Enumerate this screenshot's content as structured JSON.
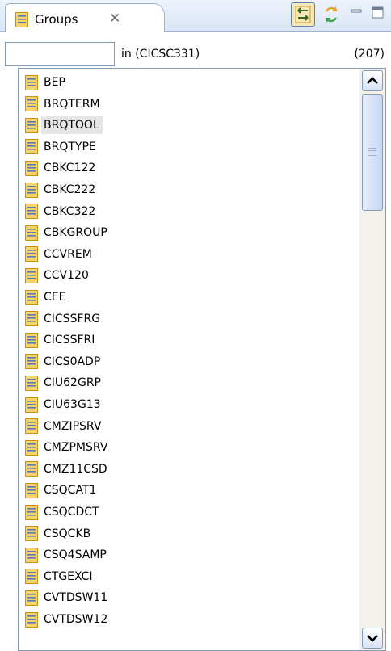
{
  "view": {
    "tab_label": "Groups",
    "tab_close_glyph": "✕",
    "icons": {
      "tab": "group-document-icon",
      "link": "link-with-editor-icon",
      "sync": "sync-icon",
      "minimize": "minimize-icon",
      "maximize": "maximize-icon"
    }
  },
  "filter": {
    "value": "",
    "placeholder": "",
    "scope_text": "in (CICSC331)",
    "count_text": "(207)"
  },
  "list": {
    "item_icon": "group-document-icon",
    "selected_index": 2,
    "items": [
      "BEP",
      "BRQTERM",
      "BRQTOOL",
      "BRQTYPE",
      "CBKC122",
      "CBKC222",
      "CBKC322",
      "CBKGROUP",
      "CCVREM",
      "CCV120",
      "CEE",
      "CICSSFRG",
      "CICSSFRI",
      "CICS0ADP",
      "CIU62GRP",
      "CIU63G13",
      "CMZIPSRV",
      "CMZPMSRV",
      "CMZ11CSD",
      "CSQCAT1",
      "CSQCDCT",
      "CSQCKB",
      "CSQ4SAMP",
      "CTGEXCI",
      "CVTDSW11",
      "CVTDSW12"
    ]
  },
  "colors": {
    "icon_fill": "#f4d46b",
    "icon_border": "#c98d12",
    "icon_lines": "#5878b8",
    "selection": "#e6e6e6",
    "tab_border": "#9fb3cf"
  }
}
